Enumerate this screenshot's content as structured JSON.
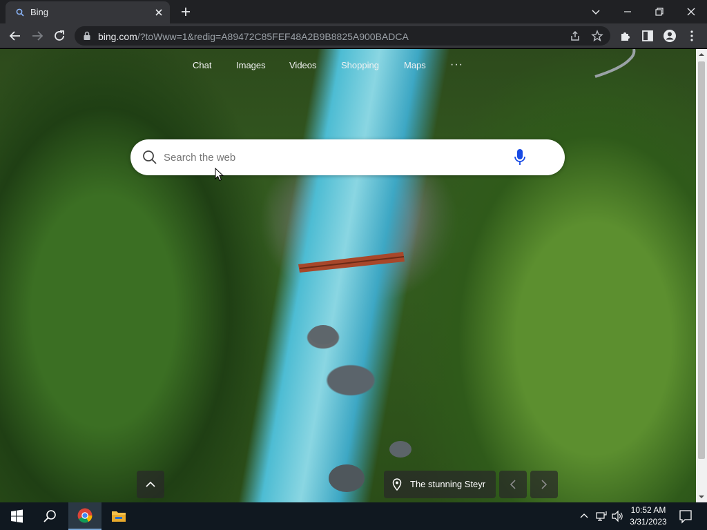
{
  "browser": {
    "tab_title": "Bing",
    "url_host": "bing.com",
    "url_rest": "/?toWww=1&redig=A89472C85FEF48A2B9B8825A900BADCA"
  },
  "bing": {
    "nav": [
      "Chat",
      "Images",
      "Videos",
      "Shopping",
      "Maps"
    ],
    "more": "···",
    "search_placeholder": "Search the web",
    "caption": "The stunning Steyr"
  },
  "taskbar": {
    "time": "10:52 AM",
    "date": "3/31/2023"
  },
  "colors": {
    "tabstrip": "#202124",
    "toolbar": "#35363a",
    "taskbar": "#101820",
    "mic": "#174ae4"
  }
}
